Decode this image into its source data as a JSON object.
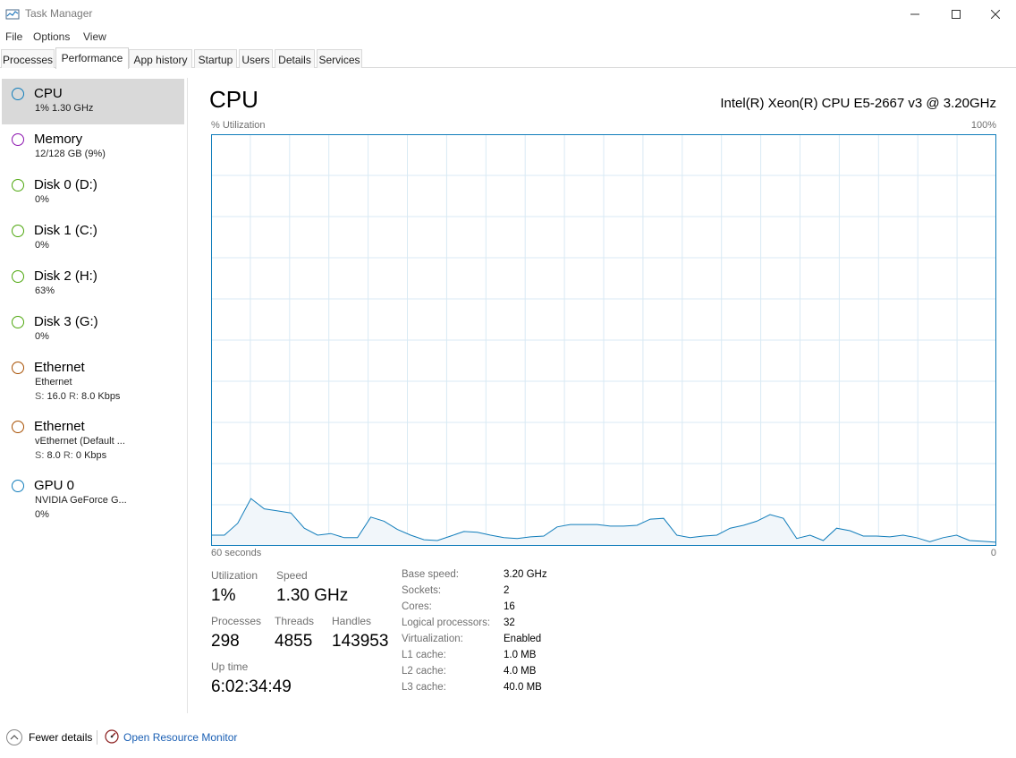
{
  "window": {
    "title": "Task Manager"
  },
  "menu": [
    "File",
    "Options",
    "View"
  ],
  "tabs": [
    "Processes",
    "Performance",
    "App history",
    "Startup",
    "Users",
    "Details",
    "Services"
  ],
  "active_tab": "Performance",
  "sidebar": {
    "items": [
      {
        "title": "CPU",
        "line1": "1% 1.30 GHz",
        "color": "#117dbb",
        "active": true
      },
      {
        "title": "Memory",
        "line1": "12/128 GB (9%)",
        "color": "#8b12ae"
      },
      {
        "title": "Disk 0 (D:)",
        "line1": "0%",
        "color": "#4da60c"
      },
      {
        "title": "Disk 1 (C:)",
        "line1": "0%",
        "color": "#4da60c"
      },
      {
        "title": "Disk 2 (H:)",
        "line1": "63%",
        "color": "#4da60c"
      },
      {
        "title": "Disk 3 (G:)",
        "line1": "0%",
        "color": "#4da60c"
      },
      {
        "title": "Ethernet",
        "line1": "Ethernet",
        "send_label": "S:",
        "send": "16.0",
        "recv_label": "R:",
        "recv": "8.0 Kbps",
        "color": "#a74f01"
      },
      {
        "title": "Ethernet",
        "line1": "vEthernet (Default ...",
        "send_label": "S:",
        "send": "8.0",
        "recv_label": "R:",
        "recv": "0 Kbps",
        "color": "#a74f01"
      },
      {
        "title": "GPU 0",
        "line1": "NVIDIA GeForce G...",
        "line2": "0%",
        "color": "#117dbb"
      }
    ]
  },
  "main": {
    "title": "CPU",
    "cpu_name": "Intel(R) Xeon(R) CPU E5-2667 v3 @ 3.20GHz",
    "graph_top_left": "% Utilization",
    "graph_top_right": "100%",
    "graph_bottom_left": "60 seconds",
    "graph_bottom_right": "0"
  },
  "stats": {
    "utilization_label": "Utilization",
    "utilization": "1%",
    "speed_label": "Speed",
    "speed": "1.30 GHz",
    "processes_label": "Processes",
    "processes": "298",
    "threads_label": "Threads",
    "threads": "4855",
    "handles_label": "Handles",
    "handles": "143953",
    "uptime_label": "Up time",
    "uptime": "6:02:34:49"
  },
  "info": [
    {
      "label": "Base speed:",
      "value": "3.20 GHz"
    },
    {
      "label": "Sockets:",
      "value": "2"
    },
    {
      "label": "Cores:",
      "value": "16"
    },
    {
      "label": "Logical processors:",
      "value": "32"
    },
    {
      "label": "Virtualization:",
      "value": "Enabled"
    },
    {
      "label": "L1 cache:",
      "value": "1.0 MB"
    },
    {
      "label": "L2 cache:",
      "value": "4.0 MB"
    },
    {
      "label": "L3 cache:",
      "value": "40.0 MB"
    }
  ],
  "footer": {
    "fewer_details": "Fewer details",
    "open_resource_monitor": "Open Resource Monitor"
  },
  "chart_data": {
    "type": "area",
    "xlabel": "60 seconds",
    "ylabel": "% Utilization",
    "xlim": [
      60,
      0
    ],
    "ylim": [
      0,
      100
    ],
    "grid": true,
    "color": "#117dbb",
    "series": [
      {
        "values": [
          2.6,
          2.6,
          5.5,
          11.5,
          9,
          8.5,
          8,
          4.3,
          2.6,
          3,
          2,
          2,
          7,
          6,
          4,
          2.6,
          1.5,
          1.3,
          2.4,
          3.5,
          3.3,
          2.6,
          2,
          1.8,
          2.2,
          2.4,
          4.6,
          5.2,
          5.2,
          5.2,
          4.8,
          4.8,
          5,
          6.5,
          6.7,
          2.6,
          2,
          2.4,
          2.6,
          4.3,
          5,
          6,
          7.6,
          6.7,
          1.8,
          2.6,
          1.3,
          4.3,
          3.7,
          2.4,
          2.4,
          2.2,
          2.6,
          2,
          1,
          2,
          2.6,
          1.3,
          1.1,
          0.9
        ]
      }
    ]
  }
}
